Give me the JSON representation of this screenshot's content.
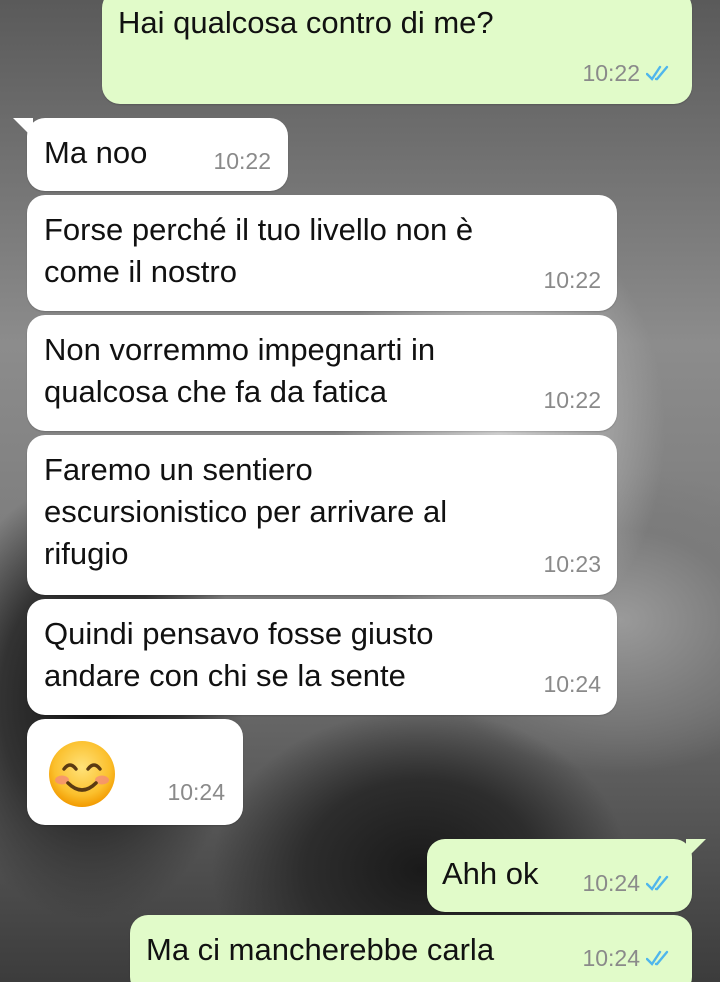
{
  "colors": {
    "incoming_bubble": "#ffffff",
    "outgoing_bubble": "#e1fbc9",
    "time_text": "#8a8a8a",
    "read_ticks": "#4fb6ec"
  },
  "messages": [
    {
      "direction": "outgoing",
      "text": "Hai qualcosa contro di me?",
      "time": "10:22",
      "status": "read"
    },
    {
      "direction": "incoming",
      "text": "Ma noo",
      "time": "10:22"
    },
    {
      "direction": "incoming",
      "text": "Forse perché il tuo livello non è\ncome il nostro",
      "time": "10:22"
    },
    {
      "direction": "incoming",
      "text": "Non vorremmo impegnarti in\nqualcosa che fa da fatica",
      "time": "10:22"
    },
    {
      "direction": "incoming",
      "text": "Faremo un sentiero\nescursionistico per arrivare al\nrifugio",
      "time": "10:23"
    },
    {
      "direction": "incoming",
      "text": "Quindi pensavo fosse giusto\nandare con chi se la sente",
      "time": "10:24"
    },
    {
      "direction": "incoming",
      "icon": "smiling-face-emoji",
      "time": "10:24"
    },
    {
      "direction": "outgoing",
      "text": "Ahh ok",
      "time": "10:24",
      "status": "read"
    },
    {
      "direction": "outgoing",
      "text": "Ma ci mancherebbe carla",
      "time": "10:24",
      "status": "read"
    }
  ]
}
